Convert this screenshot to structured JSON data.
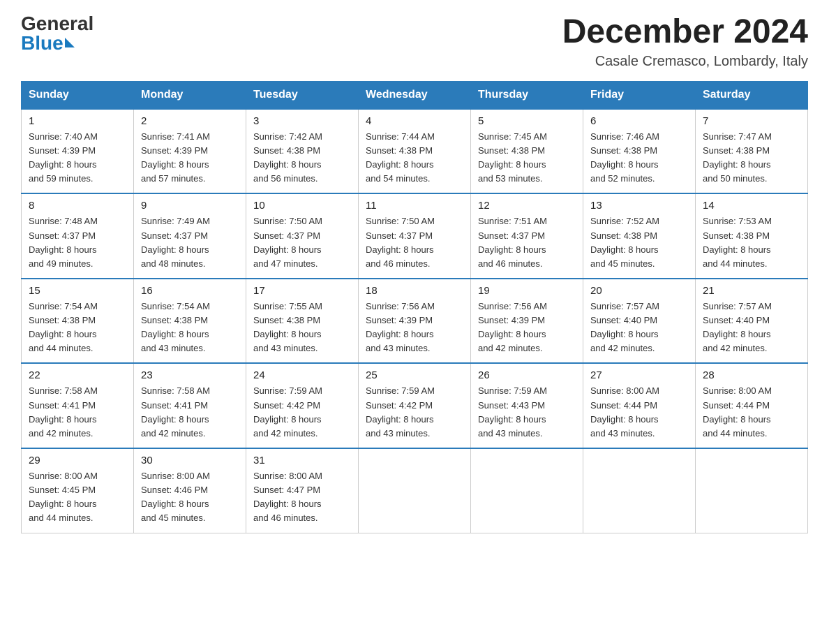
{
  "header": {
    "logo_general": "General",
    "logo_blue": "Blue",
    "month_title": "December 2024",
    "location": "Casale Cremasco, Lombardy, Italy"
  },
  "days_of_week": [
    "Sunday",
    "Monday",
    "Tuesday",
    "Wednesday",
    "Thursday",
    "Friday",
    "Saturday"
  ],
  "weeks": [
    [
      {
        "day": "1",
        "sunrise": "7:40 AM",
        "sunset": "4:39 PM",
        "daylight": "8 hours and 59 minutes."
      },
      {
        "day": "2",
        "sunrise": "7:41 AM",
        "sunset": "4:39 PM",
        "daylight": "8 hours and 57 minutes."
      },
      {
        "day": "3",
        "sunrise": "7:42 AM",
        "sunset": "4:38 PM",
        "daylight": "8 hours and 56 minutes."
      },
      {
        "day": "4",
        "sunrise": "7:44 AM",
        "sunset": "4:38 PM",
        "daylight": "8 hours and 54 minutes."
      },
      {
        "day": "5",
        "sunrise": "7:45 AM",
        "sunset": "4:38 PM",
        "daylight": "8 hours and 53 minutes."
      },
      {
        "day": "6",
        "sunrise": "7:46 AM",
        "sunset": "4:38 PM",
        "daylight": "8 hours and 52 minutes."
      },
      {
        "day": "7",
        "sunrise": "7:47 AM",
        "sunset": "4:38 PM",
        "daylight": "8 hours and 50 minutes."
      }
    ],
    [
      {
        "day": "8",
        "sunrise": "7:48 AM",
        "sunset": "4:37 PM",
        "daylight": "8 hours and 49 minutes."
      },
      {
        "day": "9",
        "sunrise": "7:49 AM",
        "sunset": "4:37 PM",
        "daylight": "8 hours and 48 minutes."
      },
      {
        "day": "10",
        "sunrise": "7:50 AM",
        "sunset": "4:37 PM",
        "daylight": "8 hours and 47 minutes."
      },
      {
        "day": "11",
        "sunrise": "7:50 AM",
        "sunset": "4:37 PM",
        "daylight": "8 hours and 46 minutes."
      },
      {
        "day": "12",
        "sunrise": "7:51 AM",
        "sunset": "4:37 PM",
        "daylight": "8 hours and 46 minutes."
      },
      {
        "day": "13",
        "sunrise": "7:52 AM",
        "sunset": "4:38 PM",
        "daylight": "8 hours and 45 minutes."
      },
      {
        "day": "14",
        "sunrise": "7:53 AM",
        "sunset": "4:38 PM",
        "daylight": "8 hours and 44 minutes."
      }
    ],
    [
      {
        "day": "15",
        "sunrise": "7:54 AM",
        "sunset": "4:38 PM",
        "daylight": "8 hours and 44 minutes."
      },
      {
        "day": "16",
        "sunrise": "7:54 AM",
        "sunset": "4:38 PM",
        "daylight": "8 hours and 43 minutes."
      },
      {
        "day": "17",
        "sunrise": "7:55 AM",
        "sunset": "4:38 PM",
        "daylight": "8 hours and 43 minutes."
      },
      {
        "day": "18",
        "sunrise": "7:56 AM",
        "sunset": "4:39 PM",
        "daylight": "8 hours and 43 minutes."
      },
      {
        "day": "19",
        "sunrise": "7:56 AM",
        "sunset": "4:39 PM",
        "daylight": "8 hours and 42 minutes."
      },
      {
        "day": "20",
        "sunrise": "7:57 AM",
        "sunset": "4:40 PM",
        "daylight": "8 hours and 42 minutes."
      },
      {
        "day": "21",
        "sunrise": "7:57 AM",
        "sunset": "4:40 PM",
        "daylight": "8 hours and 42 minutes."
      }
    ],
    [
      {
        "day": "22",
        "sunrise": "7:58 AM",
        "sunset": "4:41 PM",
        "daylight": "8 hours and 42 minutes."
      },
      {
        "day": "23",
        "sunrise": "7:58 AM",
        "sunset": "4:41 PM",
        "daylight": "8 hours and 42 minutes."
      },
      {
        "day": "24",
        "sunrise": "7:59 AM",
        "sunset": "4:42 PM",
        "daylight": "8 hours and 42 minutes."
      },
      {
        "day": "25",
        "sunrise": "7:59 AM",
        "sunset": "4:42 PM",
        "daylight": "8 hours and 43 minutes."
      },
      {
        "day": "26",
        "sunrise": "7:59 AM",
        "sunset": "4:43 PM",
        "daylight": "8 hours and 43 minutes."
      },
      {
        "day": "27",
        "sunrise": "8:00 AM",
        "sunset": "4:44 PM",
        "daylight": "8 hours and 43 minutes."
      },
      {
        "day": "28",
        "sunrise": "8:00 AM",
        "sunset": "4:44 PM",
        "daylight": "8 hours and 44 minutes."
      }
    ],
    [
      {
        "day": "29",
        "sunrise": "8:00 AM",
        "sunset": "4:45 PM",
        "daylight": "8 hours and 44 minutes."
      },
      {
        "day": "30",
        "sunrise": "8:00 AM",
        "sunset": "4:46 PM",
        "daylight": "8 hours and 45 minutes."
      },
      {
        "day": "31",
        "sunrise": "8:00 AM",
        "sunset": "4:47 PM",
        "daylight": "8 hours and 46 minutes."
      },
      null,
      null,
      null,
      null
    ]
  ]
}
